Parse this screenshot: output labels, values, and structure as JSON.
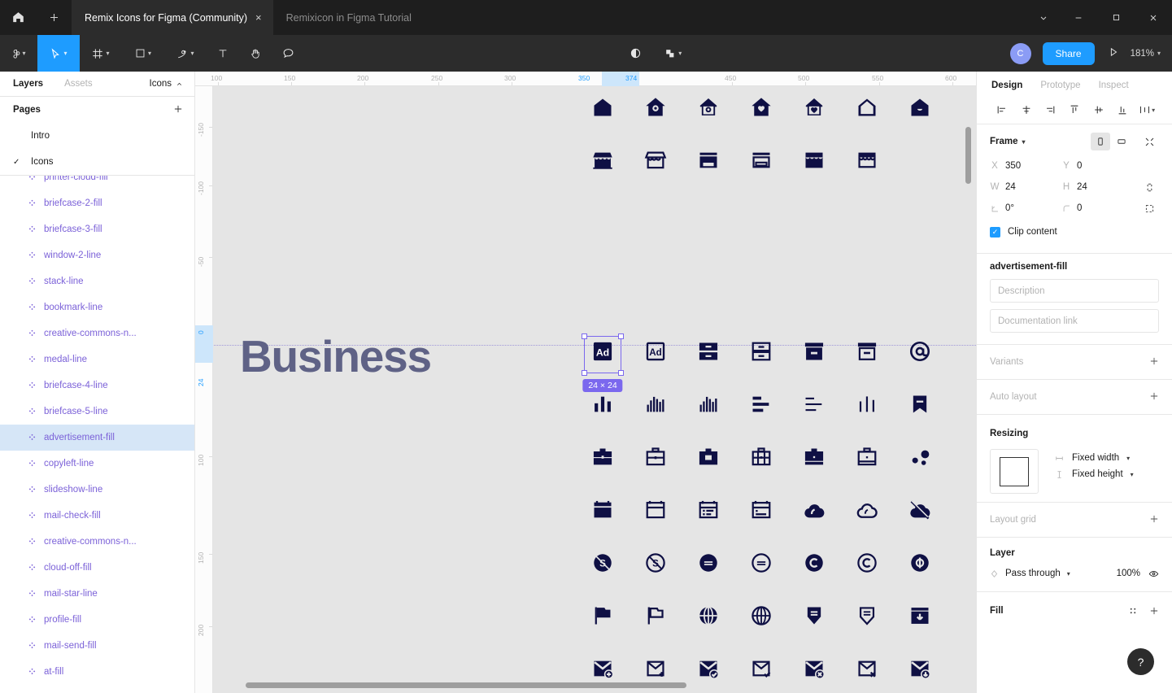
{
  "titlebar": {
    "home_icon": "home-icon",
    "new_tab_icon": "plus-icon",
    "tabs": [
      {
        "label": "Remix Icons for Figma (Community)",
        "active": true,
        "close": "×"
      },
      {
        "label": "Remixicon in Figma Tutorial",
        "active": false,
        "close": ""
      }
    ],
    "window_controls": {
      "chevron": "⌄",
      "minimize": "—",
      "maximize": "□",
      "close": "✕"
    }
  },
  "toolbar": {
    "tools": [
      {
        "name": "figma-menu-icon",
        "chevron": true
      },
      {
        "name": "move-cursor-icon",
        "chevron": true,
        "active": true
      },
      {
        "name": "frame-icon",
        "chevron": true
      },
      {
        "name": "shape-rect-icon",
        "chevron": true
      },
      {
        "name": "pen-icon",
        "chevron": true
      },
      {
        "name": "text-icon",
        "chevron": false
      },
      {
        "name": "hand-icon",
        "chevron": false
      },
      {
        "name": "comment-icon",
        "chevron": false
      }
    ],
    "center_tools": [
      {
        "name": "contrast-mask-icon",
        "chevron": false
      },
      {
        "name": "boolean-union-icon",
        "chevron": true
      }
    ],
    "avatar_initial": "C",
    "share_label": "Share",
    "present_icon": "play-icon",
    "zoom_level": "181%"
  },
  "left_panel": {
    "tabs": [
      {
        "label": "Layers",
        "active": true
      },
      {
        "label": "Assets",
        "active": false
      }
    ],
    "page_selector": {
      "label": "Icons",
      "chevron": "⌃"
    },
    "pages_header": {
      "label": "Pages",
      "add_icon": "plus-icon"
    },
    "pages": [
      {
        "label": "Intro",
        "checked": false
      },
      {
        "label": "Icons",
        "checked": true
      }
    ],
    "layers": [
      {
        "label": "printer-cloud-fill",
        "selected": false,
        "clipped_top": true
      },
      {
        "label": "briefcase-2-fill",
        "selected": false
      },
      {
        "label": "briefcase-3-fill",
        "selected": false
      },
      {
        "label": "window-2-line",
        "selected": false
      },
      {
        "label": "stack-line",
        "selected": false
      },
      {
        "label": "bookmark-line",
        "selected": false
      },
      {
        "label": "creative-commons-n...",
        "selected": false
      },
      {
        "label": "medal-line",
        "selected": false
      },
      {
        "label": "briefcase-4-line",
        "selected": false
      },
      {
        "label": "briefcase-5-line",
        "selected": false
      },
      {
        "label": "advertisement-fill",
        "selected": true
      },
      {
        "label": "copyleft-line",
        "selected": false
      },
      {
        "label": "slideshow-line",
        "selected": false
      },
      {
        "label": "mail-check-fill",
        "selected": false
      },
      {
        "label": "creative-commons-n...",
        "selected": false
      },
      {
        "label": "cloud-off-fill",
        "selected": false
      },
      {
        "label": "mail-star-line",
        "selected": false
      },
      {
        "label": "profile-fill",
        "selected": false
      },
      {
        "label": "mail-send-fill",
        "selected": false
      },
      {
        "label": "at-fill",
        "selected": false
      }
    ]
  },
  "canvas": {
    "frame_title": "Business",
    "selection_badge": "24 × 24",
    "ruler_h": {
      "ticks": [
        "100",
        "150",
        "200",
        "250",
        "300",
        "350",
        "374",
        "450",
        "500",
        "550",
        "600"
      ],
      "highlighted": [
        "350",
        "374"
      ]
    },
    "ruler_v": {
      "ticks": [
        "-150",
        "-100",
        "-50",
        "0",
        "24",
        "100",
        "150",
        "200"
      ],
      "highlighted": [
        "0",
        "24"
      ]
    },
    "icon_color": "#0f1044"
  },
  "right_panel": {
    "tabs": [
      {
        "label": "Design",
        "active": true
      },
      {
        "label": "Prototype",
        "active": false
      },
      {
        "label": "Inspect",
        "active": false
      }
    ],
    "align_buttons": [
      "align-left-icon",
      "align-horizontal-center-icon",
      "align-right-icon",
      "align-top-icon",
      "align-vertical-center-icon",
      "align-bottom-icon",
      "distribute-icon"
    ],
    "frame": {
      "label": "Frame",
      "x_key": "X",
      "x_value": "350",
      "y_key": "Y",
      "y_value": "0",
      "w_key": "W",
      "w_value": "24",
      "h_key": "H",
      "h_value": "24",
      "rotation_key": "rotate-icon",
      "rotation_value": "0°",
      "corner_key": "corner-radius-icon",
      "corner_value": "0",
      "clip_content_label": "Clip content",
      "clip_content_checked": true,
      "constrain_icon": "link-constrain-icon",
      "independent_corners_icon": "independent-corners-icon",
      "portrait_icon": "portrait-orientation-icon",
      "landscape_icon": "landscape-orientation-icon",
      "collapse_icon": "collapse-icon"
    },
    "component": {
      "name": "advertisement-fill",
      "description_placeholder": "Description",
      "doc_link_placeholder": "Documentation link"
    },
    "variants": {
      "label": "Variants",
      "add_icon": "plus-icon"
    },
    "auto_layout": {
      "label": "Auto layout",
      "add_icon": "plus-icon"
    },
    "resizing": {
      "label": "Resizing",
      "width_mode": "Fixed width",
      "height_mode": "Fixed height"
    },
    "layout_grid": {
      "label": "Layout grid",
      "add_icon": "plus-icon"
    },
    "layer": {
      "label": "Layer",
      "blend_mode": "Pass through",
      "opacity": "100%",
      "visibility_icon": "eye-icon"
    },
    "fill": {
      "label": "Fill",
      "styles_icon": "styles-icon",
      "add_icon": "plus-icon"
    },
    "help_fab": "?"
  }
}
